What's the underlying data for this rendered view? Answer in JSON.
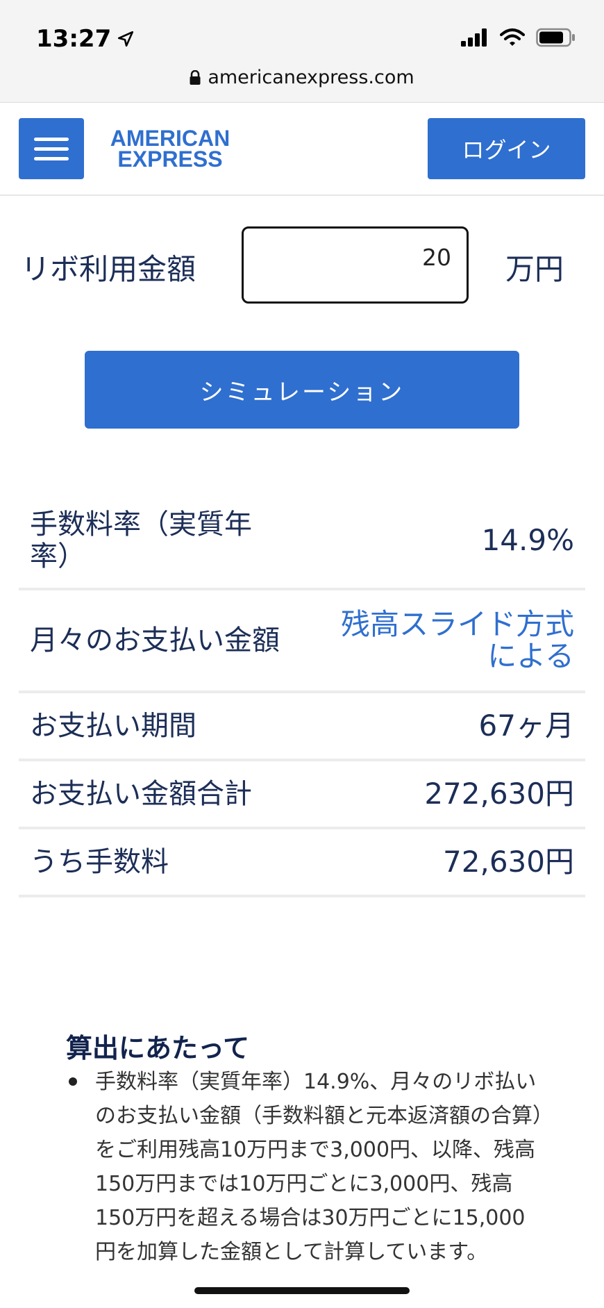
{
  "status_bar": {
    "time": "13:27"
  },
  "browser": {
    "url": "americanexpress.com"
  },
  "header": {
    "logo_line1": "AMERICAN",
    "logo_line2": "EXPRESS",
    "login_label": "ログイン"
  },
  "form": {
    "label": "リボ利用金額",
    "value": "20",
    "unit": "万円",
    "simulate_label": "シミュレーション"
  },
  "results": [
    {
      "label": "手数料率（実質年率）",
      "value": "14.9%"
    },
    {
      "label": "月々のお支払い金額",
      "value": "残高スライド方式による"
    },
    {
      "label": "お支払い期間",
      "value": "67ヶ月"
    },
    {
      "label": "お支払い金額合計",
      "value": "272,630円"
    },
    {
      "label": "うち手数料",
      "value": "72,630円"
    }
  ],
  "notes": {
    "title": "算出にあたって",
    "items": [
      "手数料率（実質年率）14.9%、月々のリボ払いのお支払い金額（手数料額と元本返済額の合算）をご利用残高10万円まで3,000円、以降、残高150万円までは10万円ごとに3,000円、残高150万円を超える場合は30万円ごとに15,000円を加算した金額として計算しています。"
    ]
  },
  "colors": {
    "brand_blue": "#2f6fcf",
    "text_navy": "#1c2e57"
  }
}
